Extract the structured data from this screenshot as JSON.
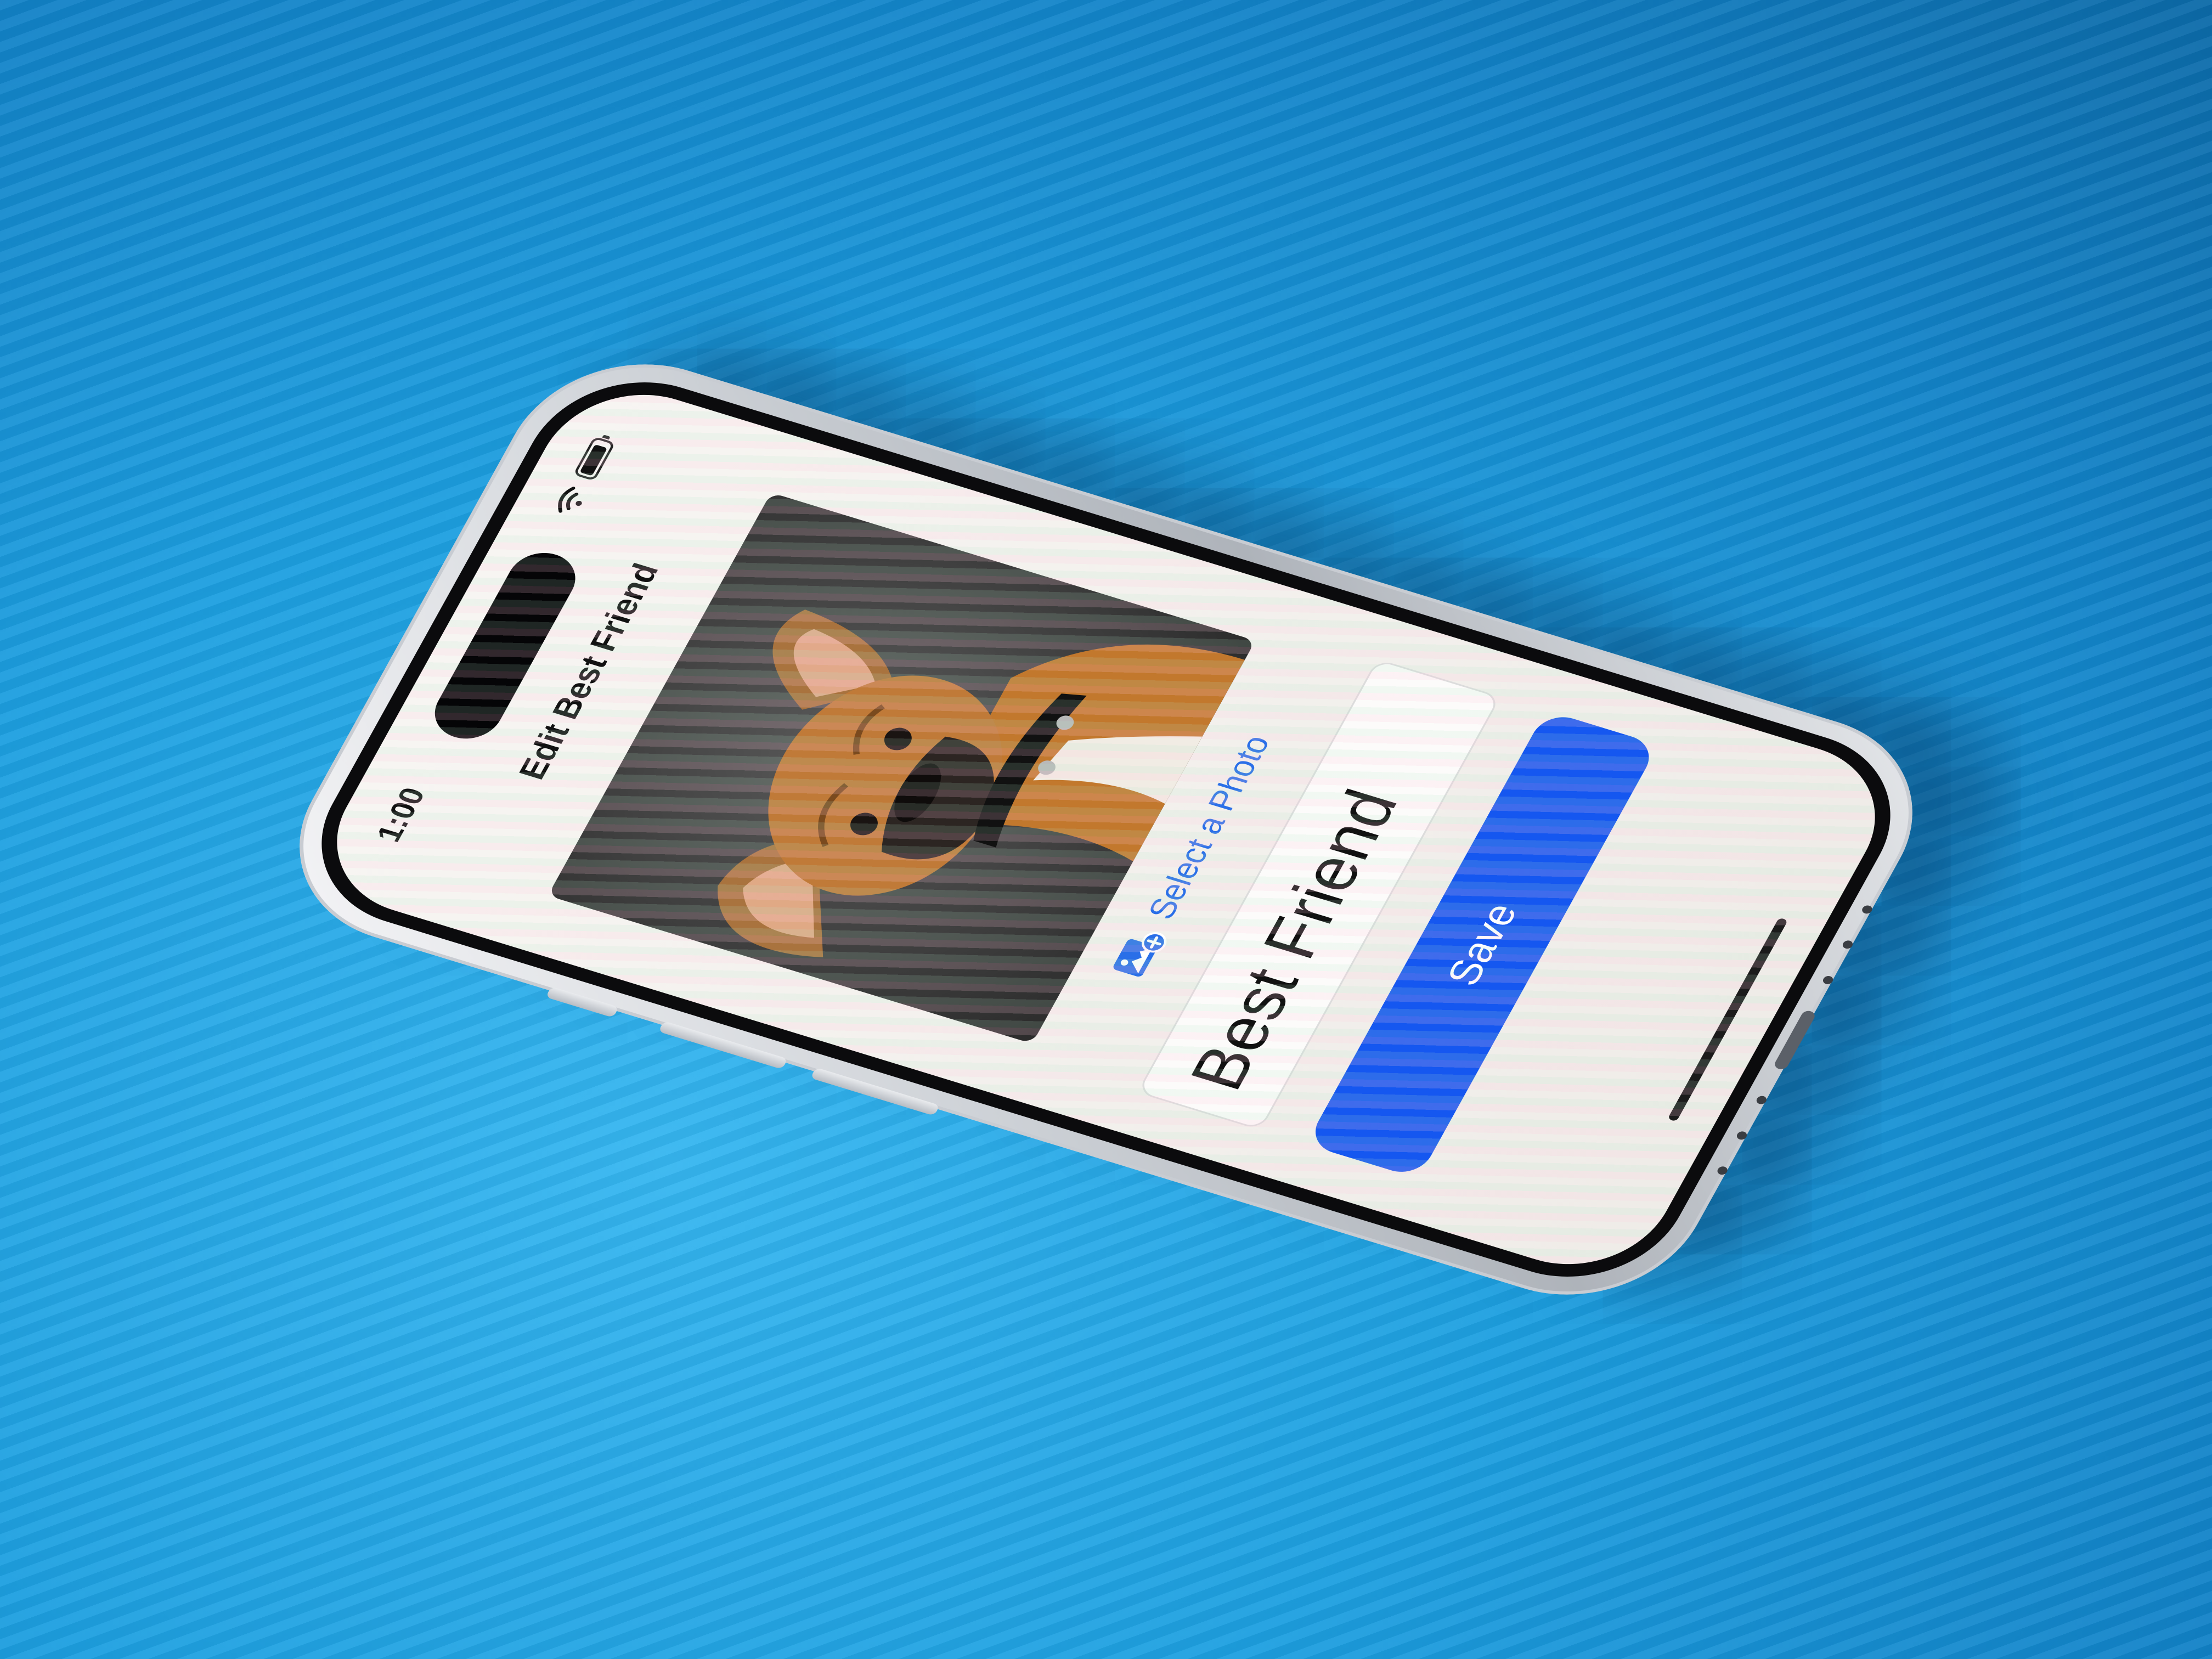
{
  "status_bar": {
    "time": "1:00",
    "wifi_icon": "wifi-icon",
    "battery_icon": "battery-icon"
  },
  "nav": {
    "title": "Edit Best Friend"
  },
  "photo": {
    "subject_icon": "dog-photo"
  },
  "select_photo": {
    "icon": "photo-add-icon",
    "label": "Select a Photo"
  },
  "name_field": {
    "value": "Best Friend"
  },
  "save": {
    "label": "Save"
  },
  "colors": {
    "accent": "#2a6fe8",
    "button": "#1557f0",
    "background": "#1d9fe0"
  }
}
